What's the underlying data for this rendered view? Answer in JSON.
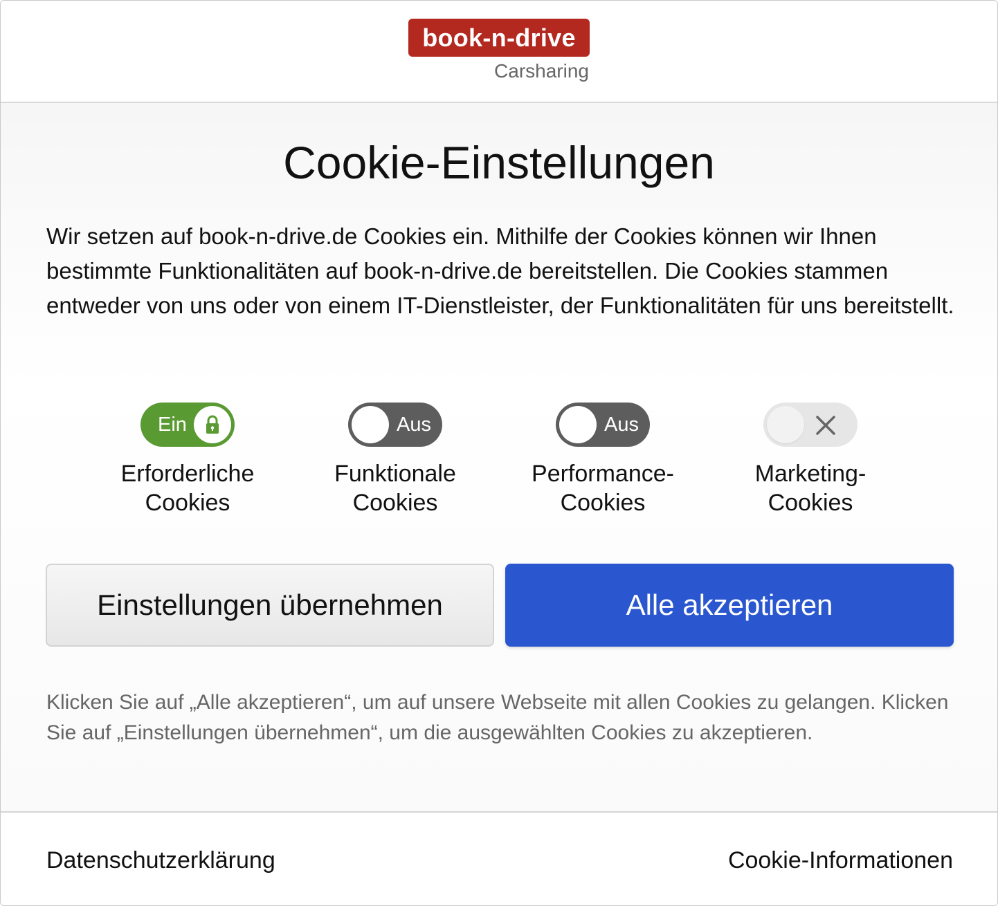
{
  "brand": {
    "logo_text": "book-n-drive",
    "subtitle": "Carsharing",
    "logo_color": "#b3281f"
  },
  "dialog": {
    "title": "Cookie-Einstellungen",
    "intro": "Wir setzen auf book-n-drive.de Cookies ein. Mithilfe der Cookies können wir Ihnen bestimmte Funktionalitäten auf book-n-drive.de bereitstellen. Die Cookies stammen entweder von uns oder von einem IT-Dienstleister, der Funktionalitäten für uns bereitstellt.",
    "toggles": [
      {
        "state_label": "Ein",
        "name_line1": "Erforderliche",
        "name_line2": "Cookies",
        "state": "on-locked",
        "icon": "lock-icon"
      },
      {
        "state_label": "Aus",
        "name_line1": "Funktionale",
        "name_line2": "Cookies",
        "state": "off"
      },
      {
        "state_label": "Aus",
        "name_line1": "Performance-",
        "name_line2": "Cookies",
        "state": "off"
      },
      {
        "state_label": "✕",
        "name_line1": "Marketing-",
        "name_line2": "Cookies",
        "state": "disabled",
        "icon": "close-icon"
      }
    ],
    "buttons": {
      "save_label": "Einstellungen übernehmen",
      "accept_all_label": "Alle akzeptieren"
    },
    "hint": "Klicken Sie auf „Alle akzeptieren“, um auf unsere Webseite mit allen Cookies zu gelangen. Klicken Sie auf „Einstellungen übernehmen“, um die ausgewählten Cookies zu akzeptieren."
  },
  "footer": {
    "privacy_link": "Datenschutzerklärung",
    "cookie_info_link": "Cookie-Informationen"
  },
  "colors": {
    "toggle_on": "#5a9a32",
    "toggle_off": "#5d5d5d",
    "toggle_disabled": "#e6e6e6",
    "primary": "#2a57cf"
  }
}
